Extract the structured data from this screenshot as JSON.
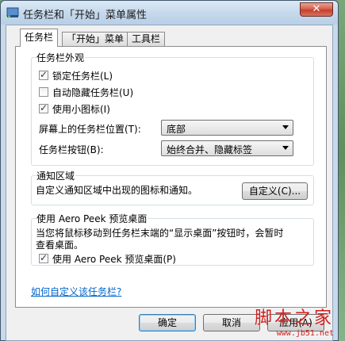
{
  "window": {
    "title": "任务栏和「开始」菜单属性",
    "close_label": "✕"
  },
  "tabs": [
    {
      "label": "任务栏",
      "active": true
    },
    {
      "label": "「开始」菜单",
      "active": false
    },
    {
      "label": "工具栏",
      "active": false
    }
  ],
  "appearance": {
    "group_label": "任务栏外观",
    "lock_taskbar": {
      "label": "锁定任务栏(L)",
      "checked": true
    },
    "auto_hide": {
      "label": "自动隐藏任务栏(U)",
      "checked": false
    },
    "small_icons": {
      "label": "使用小图标(I)",
      "checked": true
    },
    "position_label": "屏幕上的任务栏位置(T):",
    "position_value": "底部",
    "buttons_label": "任务栏按钮(B):",
    "buttons_value": "始终合并、隐藏标签"
  },
  "notification": {
    "group_label": "通知区域",
    "description": "自定义通知区域中出现的图标和通知。",
    "customize_button": "自定义(C)..."
  },
  "aero_peek": {
    "group_label": "使用 Aero Peek 预览桌面",
    "description_line1": "当您将鼠标移动到任务栏末端的“显示桌面”按钮时，会暂时",
    "description_line2": "查看桌面。",
    "checkbox": {
      "label": "使用 Aero Peek 预览桌面(P)",
      "checked": true
    }
  },
  "help_link": "如何自定义该任务栏?",
  "footer": {
    "ok_button": "确定",
    "cancel_button": "取消",
    "apply_button": "应用(A)"
  },
  "watermark": {
    "text": "脚本之家",
    "url": "www.jb51.net"
  }
}
